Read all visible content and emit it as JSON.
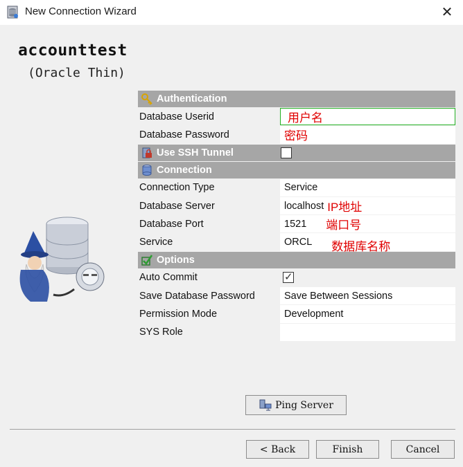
{
  "window": {
    "title": "New Connection Wizard",
    "close_glyph": "✕"
  },
  "connection": {
    "name": "accounttest",
    "driver": "(Oracle Thin)"
  },
  "sections": {
    "authentication": {
      "label": "Authentication",
      "icon": "key-icon"
    },
    "ssh": {
      "label": "Use SSH Tunnel",
      "icon": "ssh-lock-icon",
      "checked": false
    },
    "connection": {
      "label": "Connection",
      "icon": "database-icon"
    },
    "options": {
      "label": "Options",
      "icon": "checkmark-icon"
    }
  },
  "auth_fields": {
    "userid_label": "Database Userid",
    "userid_value": "用户名",
    "password_label": "Database Password",
    "password_value": "密码"
  },
  "conn_fields": {
    "type_label": "Connection Type",
    "type_value": "Service",
    "server_label": "Database Server",
    "server_value": "localhost",
    "server_anno": "IP地址",
    "port_label": "Database Port",
    "port_value": "1521",
    "port_anno": "端口号",
    "service_label": "Service",
    "service_value": "ORCL",
    "service_anno": "数据库名称"
  },
  "option_fields": {
    "autocommit_label": "Auto Commit",
    "autocommit_checked": true,
    "savepw_label": "Save Database Password",
    "savepw_value": "Save Between Sessions",
    "perm_label": "Permission Mode",
    "perm_value": "Development",
    "sys_label": "SYS Role",
    "sys_value": ""
  },
  "buttons": {
    "ping": "Ping Server",
    "back": "< Back",
    "finish": "Finish",
    "cancel": "Cancel"
  },
  "colors": {
    "section_bg": "#a6a6a6",
    "annotation": "#e00000",
    "focus_border": "#22b022"
  }
}
